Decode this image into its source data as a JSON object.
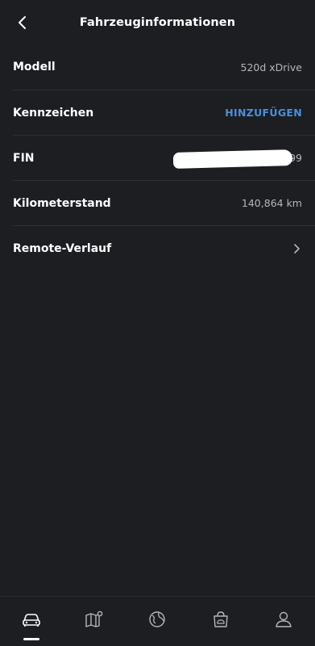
{
  "header": {
    "title": "Fahrzeuginformationen",
    "back_icon": "chevron-left-icon"
  },
  "rows": [
    {
      "label": "Modell",
      "value": "520d xDrive"
    },
    {
      "label": "Kennzeichen",
      "action": "HINZUFÜGEN"
    },
    {
      "label": "FIN",
      "value": "…99"
    },
    {
      "label": "Kilometerstand",
      "value": "140,864 km"
    },
    {
      "label": "Remote-Verlauf",
      "icon": "chevron-right-icon"
    }
  ],
  "tabbar": {
    "tabs": [
      {
        "icon": "car-icon",
        "active": true
      },
      {
        "icon": "map-icon",
        "active": false
      },
      {
        "icon": "globe-icon",
        "active": false
      },
      {
        "icon": "shop-icon",
        "active": false
      },
      {
        "icon": "profile-icon",
        "active": false
      }
    ]
  },
  "colors": {
    "background": "#1c1e22",
    "divider": "#2c2f34",
    "link": "#4a90d9",
    "secondary_text": "#b3b6bc"
  }
}
